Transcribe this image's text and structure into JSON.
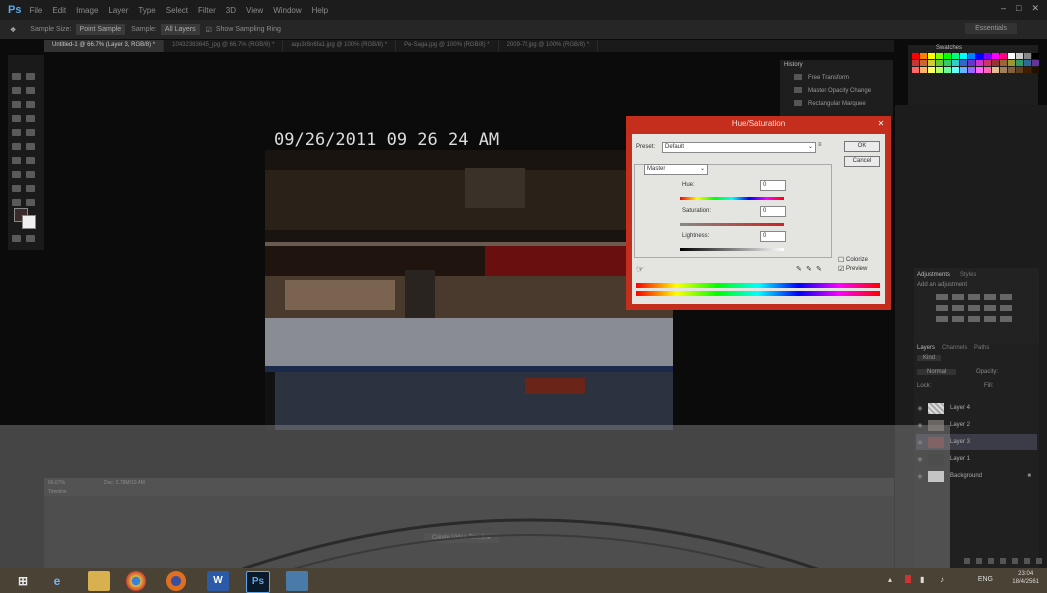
{
  "app": {
    "logo": "Ps"
  },
  "menu": [
    "File",
    "Edit",
    "Image",
    "Layer",
    "Type",
    "Select",
    "Filter",
    "3D",
    "View",
    "Window",
    "Help"
  ],
  "options": {
    "sample_size_label": "Sample Size:",
    "sample_size_value": "Point Sample",
    "sample_label": "Sample:",
    "sample_value": "All Layers",
    "show_ring": "Show Sampling Ring",
    "workspace": "Essentials"
  },
  "tabs": [
    {
      "label": "Untitled-1 @ 66.7% (Layer 3, RGB/8) *",
      "active": true
    },
    {
      "label": "10432383645_jpg @ 66.7% (RGB/8) *",
      "active": false
    },
    {
      "label": "aqu3r8n6fa1.jpg @ 100% (RGB/8) *",
      "active": false
    },
    {
      "label": "Pe-Saga.jpg @ 100% (RGB/8) *",
      "active": false
    },
    {
      "label": "2009-7f.jpg @ 100% (RGB/8) *",
      "active": false
    }
  ],
  "canvas": {
    "timestamp": "09/26/2011 09 26 24 AM"
  },
  "history": {
    "items": [
      "Free Transform",
      "Master Opacity Change",
      "Rectangular Marquee"
    ]
  },
  "swatches": {
    "title": "Swatches",
    "colors": [
      "#ff0000",
      "#ff8000",
      "#ffff00",
      "#80ff00",
      "#00ff00",
      "#00ff80",
      "#00ffff",
      "#0080ff",
      "#0000ff",
      "#8000ff",
      "#ff00ff",
      "#ff0080",
      "#ffffff",
      "#cccccc",
      "#888888",
      "#000000",
      "#cc3333",
      "#cc6633",
      "#cccc33",
      "#66cc33",
      "#33cc66",
      "#33cccc",
      "#3366cc",
      "#6633cc",
      "#cc33cc",
      "#cc3366",
      "#993333",
      "#996633",
      "#999933",
      "#339966",
      "#336699",
      "#663399",
      "#ff6666",
      "#ffb366",
      "#ffff66",
      "#b3ff66",
      "#66ff99",
      "#66ffff",
      "#66b3ff",
      "#9966ff",
      "#ff66ff",
      "#ff66b3",
      "#e0c090",
      "#a08060",
      "#806040",
      "#604020",
      "#402000",
      "#201000"
    ]
  },
  "adjustments": {
    "title": "Adjustments",
    "tab2": "Styles",
    "hint": "Add an adjustment"
  },
  "layers": {
    "tabs": [
      "Layers",
      "Channels",
      "Paths"
    ],
    "kind": "Kind",
    "blend": "Normal",
    "opacity_label": "Opacity:",
    "fill_label": "Fill:",
    "lock_label": "Lock:",
    "items": [
      {
        "name": "Layer 4",
        "selected": false
      },
      {
        "name": "Layer 2",
        "selected": false
      },
      {
        "name": "Layer 3",
        "selected": true
      },
      {
        "name": "Layer 1",
        "selected": false
      },
      {
        "name": "Background",
        "selected": false
      }
    ]
  },
  "hue_saturation": {
    "title": "Hue/Saturation",
    "preset_label": "Preset:",
    "preset_value": "Default",
    "channel": "Master",
    "hue_label": "Hue:",
    "hue_value": "0",
    "saturation_label": "Saturation:",
    "saturation_value": "0",
    "lightness_label": "Lightness:",
    "lightness_value": "0",
    "ok": "OK",
    "cancel": "Cancel",
    "colorize": "Colorize",
    "preview": "Preview",
    "preview_checked": true,
    "colorize_checked": false
  },
  "status": {
    "zoom": "66.67%",
    "doc": "Doc: 2.78M/10.4M"
  },
  "timeline": {
    "title": "Timeline",
    "create_button": "Create Video Timeline"
  },
  "taskbar": {
    "lang": "ENG",
    "time": "23:04",
    "date": "18/4/2561"
  }
}
